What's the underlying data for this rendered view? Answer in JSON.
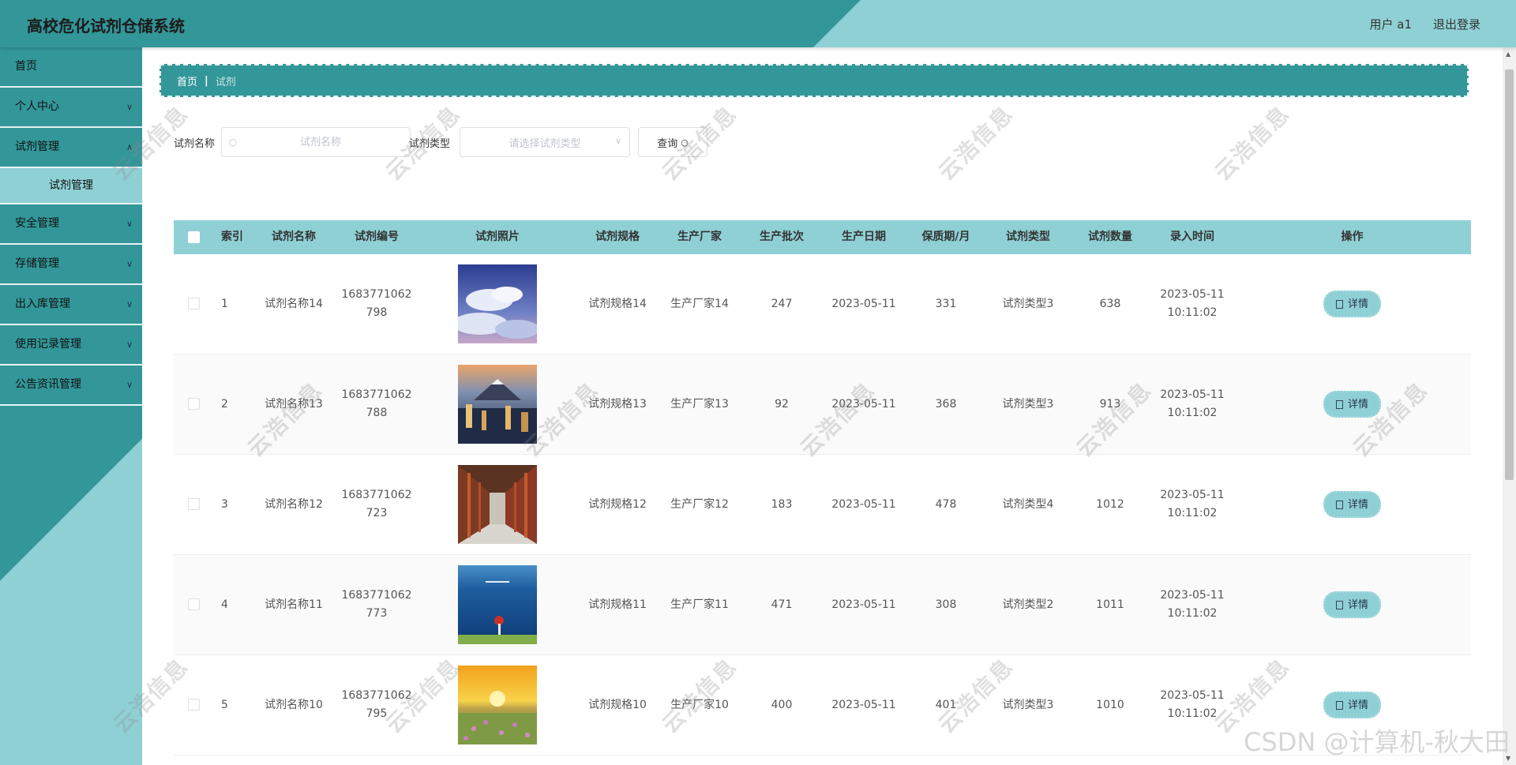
{
  "header": {
    "title": "高校危化试剂仓储系统",
    "user_label": "用户 a1",
    "logout_label": "退出登录"
  },
  "sidebar": {
    "items": [
      {
        "label": "首页",
        "has_children": false
      },
      {
        "label": "个人中心",
        "has_children": true
      },
      {
        "label": "试剂管理",
        "has_children": true,
        "expanded": true,
        "sub": [
          "试剂管理"
        ]
      },
      {
        "label": "安全管理",
        "has_children": true
      },
      {
        "label": "存储管理",
        "has_children": true
      },
      {
        "label": "出入库管理",
        "has_children": true
      },
      {
        "label": "使用记录管理",
        "has_children": true
      },
      {
        "label": "公告资讯管理",
        "has_children": true
      }
    ]
  },
  "breadcrumb": {
    "home": "首页",
    "current": "试剂"
  },
  "search": {
    "name_label": "试剂名称",
    "name_placeholder": "试剂名称",
    "type_label": "试剂类型",
    "type_placeholder": "请选择试剂类型",
    "query_label": "查询"
  },
  "table": {
    "headers": [
      "索引",
      "试剂名称",
      "试剂编号",
      "试剂照片",
      "试剂规格",
      "生产厂家",
      "生产批次",
      "生产日期",
      "保质期/月",
      "试剂类型",
      "试剂数量",
      "录入时间",
      "操作"
    ],
    "detail_label": "详情",
    "rows": [
      {
        "index": "1",
        "name": "试剂名称14",
        "code_a": "1683771062",
        "code_b": "798",
        "photo": "sky-clouds",
        "spec": "试剂规格14",
        "mfr": "生产厂家14",
        "batch": "247",
        "date": "2023-05-11",
        "shelf": "331",
        "type": "试剂类型3",
        "qty": "638",
        "time_a": "2023-05-11",
        "time_b": "10:11:02"
      },
      {
        "index": "2",
        "name": "试剂名称13",
        "code_a": "1683771062",
        "code_b": "788",
        "photo": "city-mountain",
        "spec": "试剂规格13",
        "mfr": "生产厂家13",
        "batch": "92",
        "date": "2023-05-11",
        "shelf": "368",
        "type": "试剂类型3",
        "qty": "913",
        "time_a": "2023-05-11",
        "time_b": "10:11:02"
      },
      {
        "index": "3",
        "name": "试剂名称12",
        "code_a": "1683771062",
        "code_b": "723",
        "photo": "corridor",
        "spec": "试剂规格12",
        "mfr": "生产厂家12",
        "batch": "183",
        "date": "2023-05-11",
        "shelf": "478",
        "type": "试剂类型4",
        "qty": "1012",
        "time_a": "2023-05-11",
        "time_b": "10:11:02"
      },
      {
        "index": "4",
        "name": "试剂名称11",
        "code_a": "1683771062",
        "code_b": "773",
        "photo": "sea-umbrella",
        "spec": "试剂规格11",
        "mfr": "生产厂家11",
        "batch": "471",
        "date": "2023-05-11",
        "shelf": "308",
        "type": "试剂类型2",
        "qty": "1011",
        "time_a": "2023-05-11",
        "time_b": "10:11:02"
      },
      {
        "index": "5",
        "name": "试剂名称10",
        "code_a": "1683771062",
        "code_b": "795",
        "photo": "sunset-field",
        "spec": "试剂规格10",
        "mfr": "生产厂家10",
        "batch": "400",
        "date": "2023-05-11",
        "shelf": "401",
        "type": "试剂类型3",
        "qty": "1010",
        "time_a": "2023-05-11",
        "time_b": "10:11:02"
      }
    ]
  },
  "watermark": "云浩信息",
  "csdn_mark": "CSDN @计算机-秋大田",
  "colors": {
    "primary": "#339699",
    "accent": "#8fd0d5"
  }
}
